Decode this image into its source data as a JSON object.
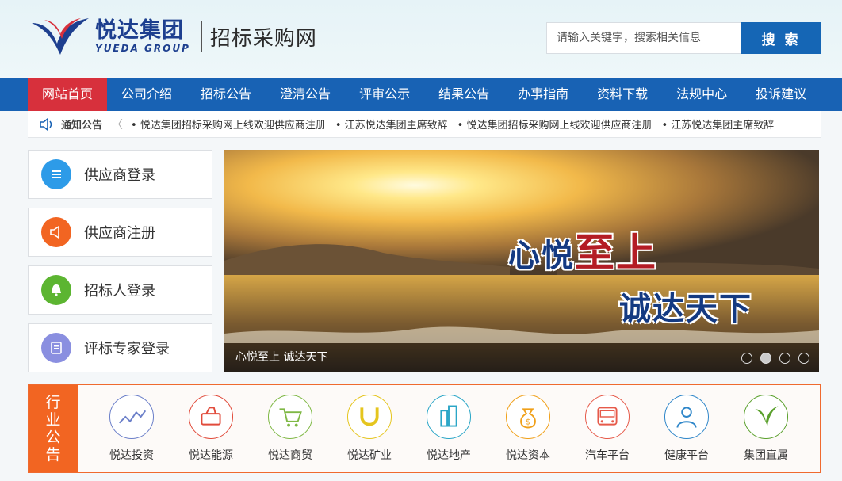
{
  "header": {
    "logo_cn": "悦达集团",
    "logo_en": "YUEDA GROUP",
    "site_name": "招标采购网",
    "search_placeholder": "请输入关键字，搜索相关信息",
    "search_button": "搜 索"
  },
  "nav": {
    "items": [
      {
        "label": "网站首页",
        "active": true
      },
      {
        "label": "公司介绍"
      },
      {
        "label": "招标公告"
      },
      {
        "label": "澄清公告"
      },
      {
        "label": "评审公示"
      },
      {
        "label": "结果公告"
      },
      {
        "label": "办事指南"
      },
      {
        "label": "资料下载"
      },
      {
        "label": "法规中心"
      },
      {
        "label": "投诉建议"
      }
    ]
  },
  "notice": {
    "label": "通知公告",
    "items": [
      "• 悦达集团招标采购网上线欢迎供应商注册",
      "• 江苏悦达集团主席致辞",
      "• 悦达集团招标采购网上线欢迎供应商注册",
      "• 江苏悦达集团主席致辞"
    ]
  },
  "sidebar": {
    "items": [
      {
        "label": "供应商登录",
        "icon": "list-icon",
        "color": "#2d9be8"
      },
      {
        "label": "供应商注册",
        "icon": "megaphone-icon",
        "color": "#f26522"
      },
      {
        "label": "招标人登录",
        "icon": "bell-icon",
        "color": "#5cb531"
      },
      {
        "label": "评标专家登录",
        "icon": "document-icon",
        "color": "#8a8fe0"
      }
    ]
  },
  "banner": {
    "slogan_small": "心悦",
    "slogan_big": "至上",
    "slogan_line2": "诚达天下",
    "caption": "心悦至上 诚达天下",
    "active_slide": 2,
    "slide_count": 4
  },
  "industry": {
    "label_chars": [
      "行",
      "业",
      "公",
      "告"
    ],
    "items": [
      {
        "label": "悦达投资",
        "icon": "chart-icon",
        "color": "#6b7fc9"
      },
      {
        "label": "悦达能源",
        "icon": "energy-icon",
        "color": "#e14b3b"
      },
      {
        "label": "悦达商贸",
        "icon": "cart-icon",
        "color": "#7fb845"
      },
      {
        "label": "悦达矿业",
        "icon": "magnet-icon",
        "color": "#e5c51e"
      },
      {
        "label": "悦达地产",
        "icon": "building-icon",
        "color": "#2aa6c7"
      },
      {
        "label": "悦达资本",
        "icon": "money-bag-icon",
        "color": "#f0a019"
      },
      {
        "label": "汽车平台",
        "icon": "bus-icon",
        "color": "#e65a4a"
      },
      {
        "label": "健康平台",
        "icon": "doctor-icon",
        "color": "#2e86c9"
      },
      {
        "label": "集团直属",
        "icon": "leaf-logo-icon",
        "color": "#5aa02c"
      }
    ]
  }
}
